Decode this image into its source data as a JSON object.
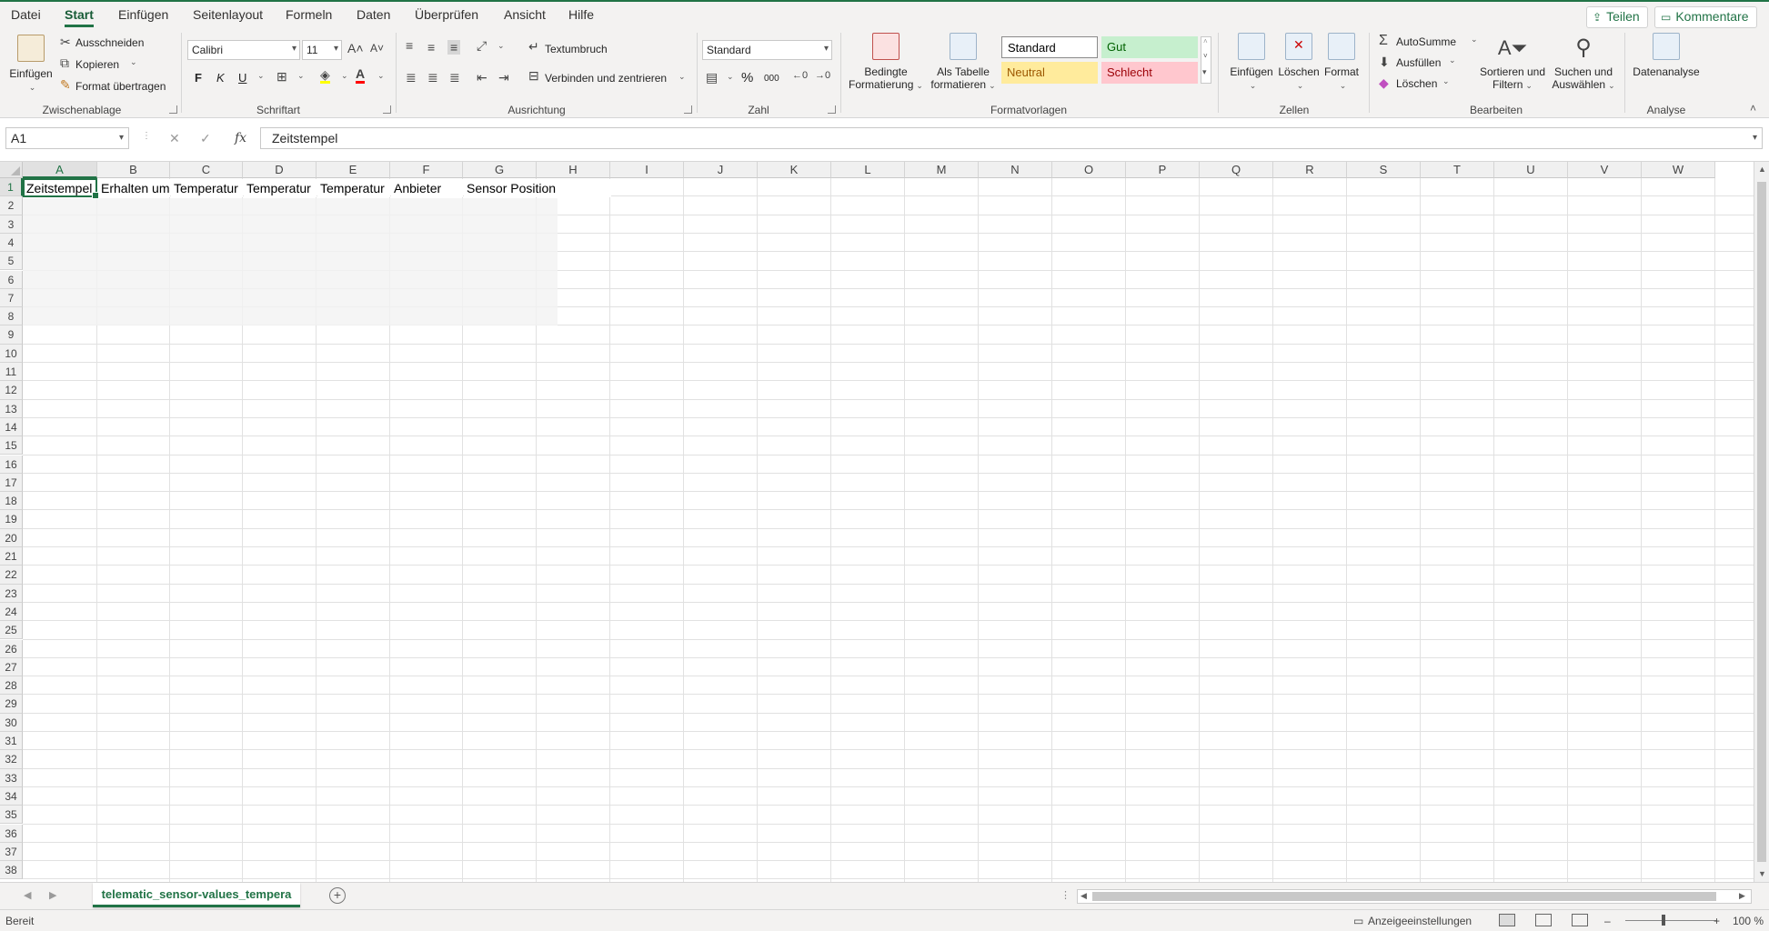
{
  "menu": {
    "tabs": [
      "Datei",
      "Start",
      "Einfügen",
      "Seitenlayout",
      "Formeln",
      "Daten",
      "Überprüfen",
      "Ansicht",
      "Hilfe"
    ],
    "active": "Start",
    "share_label": "Teilen",
    "comments_label": "Kommentare"
  },
  "ribbon": {
    "clipboard": {
      "paste": "Einfügen",
      "cut": "Ausschneiden",
      "copy": "Kopieren",
      "format_painter": "Format übertragen",
      "group": "Zwischenablage"
    },
    "font": {
      "name": "Calibri",
      "size": "11",
      "bold": "F",
      "italic": "K",
      "underline": "U",
      "group": "Schriftart"
    },
    "alignment": {
      "wrap": "Textumbruch",
      "merge": "Verbinden und zentrieren",
      "group": "Ausrichtung"
    },
    "number": {
      "format": "Standard",
      "percent": "%",
      "thousands": "000",
      "group": "Zahl"
    },
    "styles": {
      "conditional_1": "Bedingte",
      "conditional_2": "Formatierung",
      "table_1": "Als Tabelle",
      "table_2": "formatieren",
      "standard": "Standard",
      "good": "Gut",
      "neutral": "Neutral",
      "bad": "Schlecht",
      "group": "Formatvorlagen"
    },
    "cells": {
      "insert": "Einfügen",
      "delete": "Löschen",
      "format": "Format",
      "group": "Zellen"
    },
    "editing": {
      "autosum": "AutoSumme",
      "fill": "Ausfüllen",
      "clear": "Löschen",
      "sort_1": "Sortieren und",
      "sort_2": "Filtern",
      "find_1": "Suchen und",
      "find_2": "Auswählen",
      "group": "Bearbeiten"
    },
    "analysis": {
      "data_analysis": "Datenanalyse",
      "group": "Analyse"
    }
  },
  "formula_bar": {
    "name_box": "A1",
    "fx": "fx",
    "content": "Zeitstempel"
  },
  "grid": {
    "columns": [
      "A",
      "B",
      "C",
      "D",
      "E",
      "F",
      "G",
      "H",
      "I",
      "J",
      "K",
      "L",
      "M",
      "N",
      "O",
      "P",
      "Q",
      "R",
      "S",
      "T",
      "U",
      "V",
      "W"
    ],
    "rows": [
      "1",
      "2",
      "3",
      "4",
      "5",
      "6",
      "7",
      "8",
      "9",
      "10",
      "11",
      "12",
      "13",
      "14",
      "15",
      "16",
      "17",
      "18",
      "19",
      "20",
      "21",
      "22",
      "23",
      "24",
      "25",
      "26",
      "27",
      "28",
      "29",
      "30",
      "31",
      "32",
      "33",
      "34",
      "35",
      "36",
      "37",
      "38"
    ],
    "row1": [
      "Zeitstempel",
      "Erhalten um",
      "Temperatur",
      "Temperatur",
      "Temperatur",
      "Anbieter",
      "Sensor Position"
    ],
    "selected_cell": "A1"
  },
  "sheet": {
    "tab_name": "telematic_sensor-values_tempera"
  },
  "status": {
    "ready": "Bereit",
    "display_settings": "Anzeigeeinstellungen",
    "zoom": "100 %"
  },
  "colors": {
    "accent": "#217346",
    "good_bg": "#c6efce",
    "good_fg": "#006100",
    "neutral_bg": "#ffeb9c",
    "neutral_fg": "#9c5700",
    "bad_bg": "#ffc7ce",
    "bad_fg": "#9c0006"
  }
}
